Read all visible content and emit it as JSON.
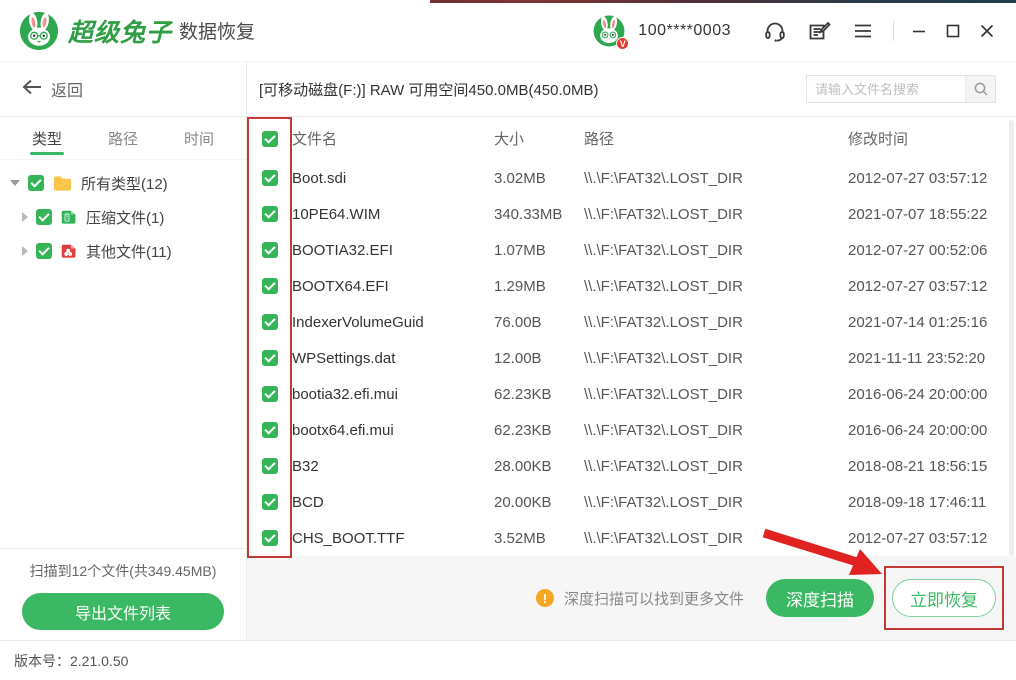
{
  "colors": {
    "accent_green": "#3bb863",
    "logo_green": "#2f9e44",
    "checkbox_green": "#35b558",
    "warning_orange": "#f5a623",
    "annotation_red": "#c13a34",
    "other_icon_red": "#e23c3c",
    "folder_yellow": "#f8c64a"
  },
  "icons": [
    "rabbit-logo-icon",
    "v-badge",
    "support-headset-icon",
    "feedback-icon",
    "menu-icon",
    "minimize-icon",
    "maximize-icon",
    "close-icon",
    "back-arrow-icon",
    "folder-icon",
    "archive-file-icon",
    "other-file-icon",
    "search-icon",
    "warning-icon",
    "checkbox-checked"
  ],
  "header": {
    "brand": "超级兔子",
    "brand_suffix": "数据恢复",
    "account": "100****0003",
    "v_badge": "V"
  },
  "toolbar": {
    "back_label": "返回",
    "drive_info": "[可移动磁盘(F:)] RAW 可用空间450.0MB(450.0MB)",
    "search_placeholder": "请输入文件名搜索"
  },
  "sidebar": {
    "tabs": [
      {
        "label": "类型",
        "active": true
      },
      {
        "label": "路径",
        "active": false
      },
      {
        "label": "时间",
        "active": false
      }
    ],
    "tree": [
      {
        "label": "所有类型(12)",
        "icon": "folder-icon",
        "expanded": true,
        "checked": true
      },
      {
        "label": "压缩文件(1)",
        "icon": "archive-file-icon",
        "expanded": false,
        "checked": true
      },
      {
        "label": "其他文件(11)",
        "icon": "other-file-icon",
        "expanded": false,
        "checked": true
      }
    ],
    "summary": "扫描到12个文件(共349.45MB)",
    "export_button": "导出文件列表"
  },
  "table": {
    "headers": {
      "name": "文件名",
      "size": "大小",
      "path": "路径",
      "time": "修改时间"
    },
    "rows": [
      {
        "name": "Boot.sdi",
        "size": "3.02MB",
        "path": "\\\\.\\F:\\FAT32\\.LOST_DIR",
        "time": "2012-07-27 03:57:12",
        "checked": true
      },
      {
        "name": "10PE64.WIM",
        "size": "340.33MB",
        "path": "\\\\.\\F:\\FAT32\\.LOST_DIR",
        "time": "2021-07-07 18:55:22",
        "checked": true
      },
      {
        "name": "BOOTIA32.EFI",
        "size": "1.07MB",
        "path": "\\\\.\\F:\\FAT32\\.LOST_DIR",
        "time": "2012-07-27 00:52:06",
        "checked": true
      },
      {
        "name": "BOOTX64.EFI",
        "size": "1.29MB",
        "path": "\\\\.\\F:\\FAT32\\.LOST_DIR",
        "time": "2012-07-27 03:57:12",
        "checked": true
      },
      {
        "name": "IndexerVolumeGuid",
        "size": "76.00B",
        "path": "\\\\.\\F:\\FAT32\\.LOST_DIR",
        "time": "2021-07-14 01:25:16",
        "checked": true
      },
      {
        "name": "WPSettings.dat",
        "size": "12.00B",
        "path": "\\\\.\\F:\\FAT32\\.LOST_DIR",
        "time": "2021-11-11 23:52:20",
        "checked": true
      },
      {
        "name": "bootia32.efi.mui",
        "size": "62.23KB",
        "path": "\\\\.\\F:\\FAT32\\.LOST_DIR",
        "time": "2016-06-24 20:00:00",
        "checked": true
      },
      {
        "name": "bootx64.efi.mui",
        "size": "62.23KB",
        "path": "\\\\.\\F:\\FAT32\\.LOST_DIR",
        "time": "2016-06-24 20:00:00",
        "checked": true
      },
      {
        "name": "B32",
        "size": "28.00KB",
        "path": "\\\\.\\F:\\FAT32\\.LOST_DIR",
        "time": "2018-08-21 18:56:15",
        "checked": true
      },
      {
        "name": "BCD",
        "size": "20.00KB",
        "path": "\\\\.\\F:\\FAT32\\.LOST_DIR",
        "time": "2018-09-18 17:46:11",
        "checked": true
      },
      {
        "name": "CHS_BOOT.TTF",
        "size": "3.52MB",
        "path": "\\\\.\\F:\\FAT32\\.LOST_DIR",
        "time": "2012-07-27 03:57:12",
        "checked": true
      }
    ]
  },
  "bottom_bar": {
    "notice": "深度扫描可以找到更多文件",
    "deep_scan_button": "深度扫描",
    "recover_button": "立即恢复"
  },
  "footer": {
    "version": "版本号：2.21.0.50"
  }
}
